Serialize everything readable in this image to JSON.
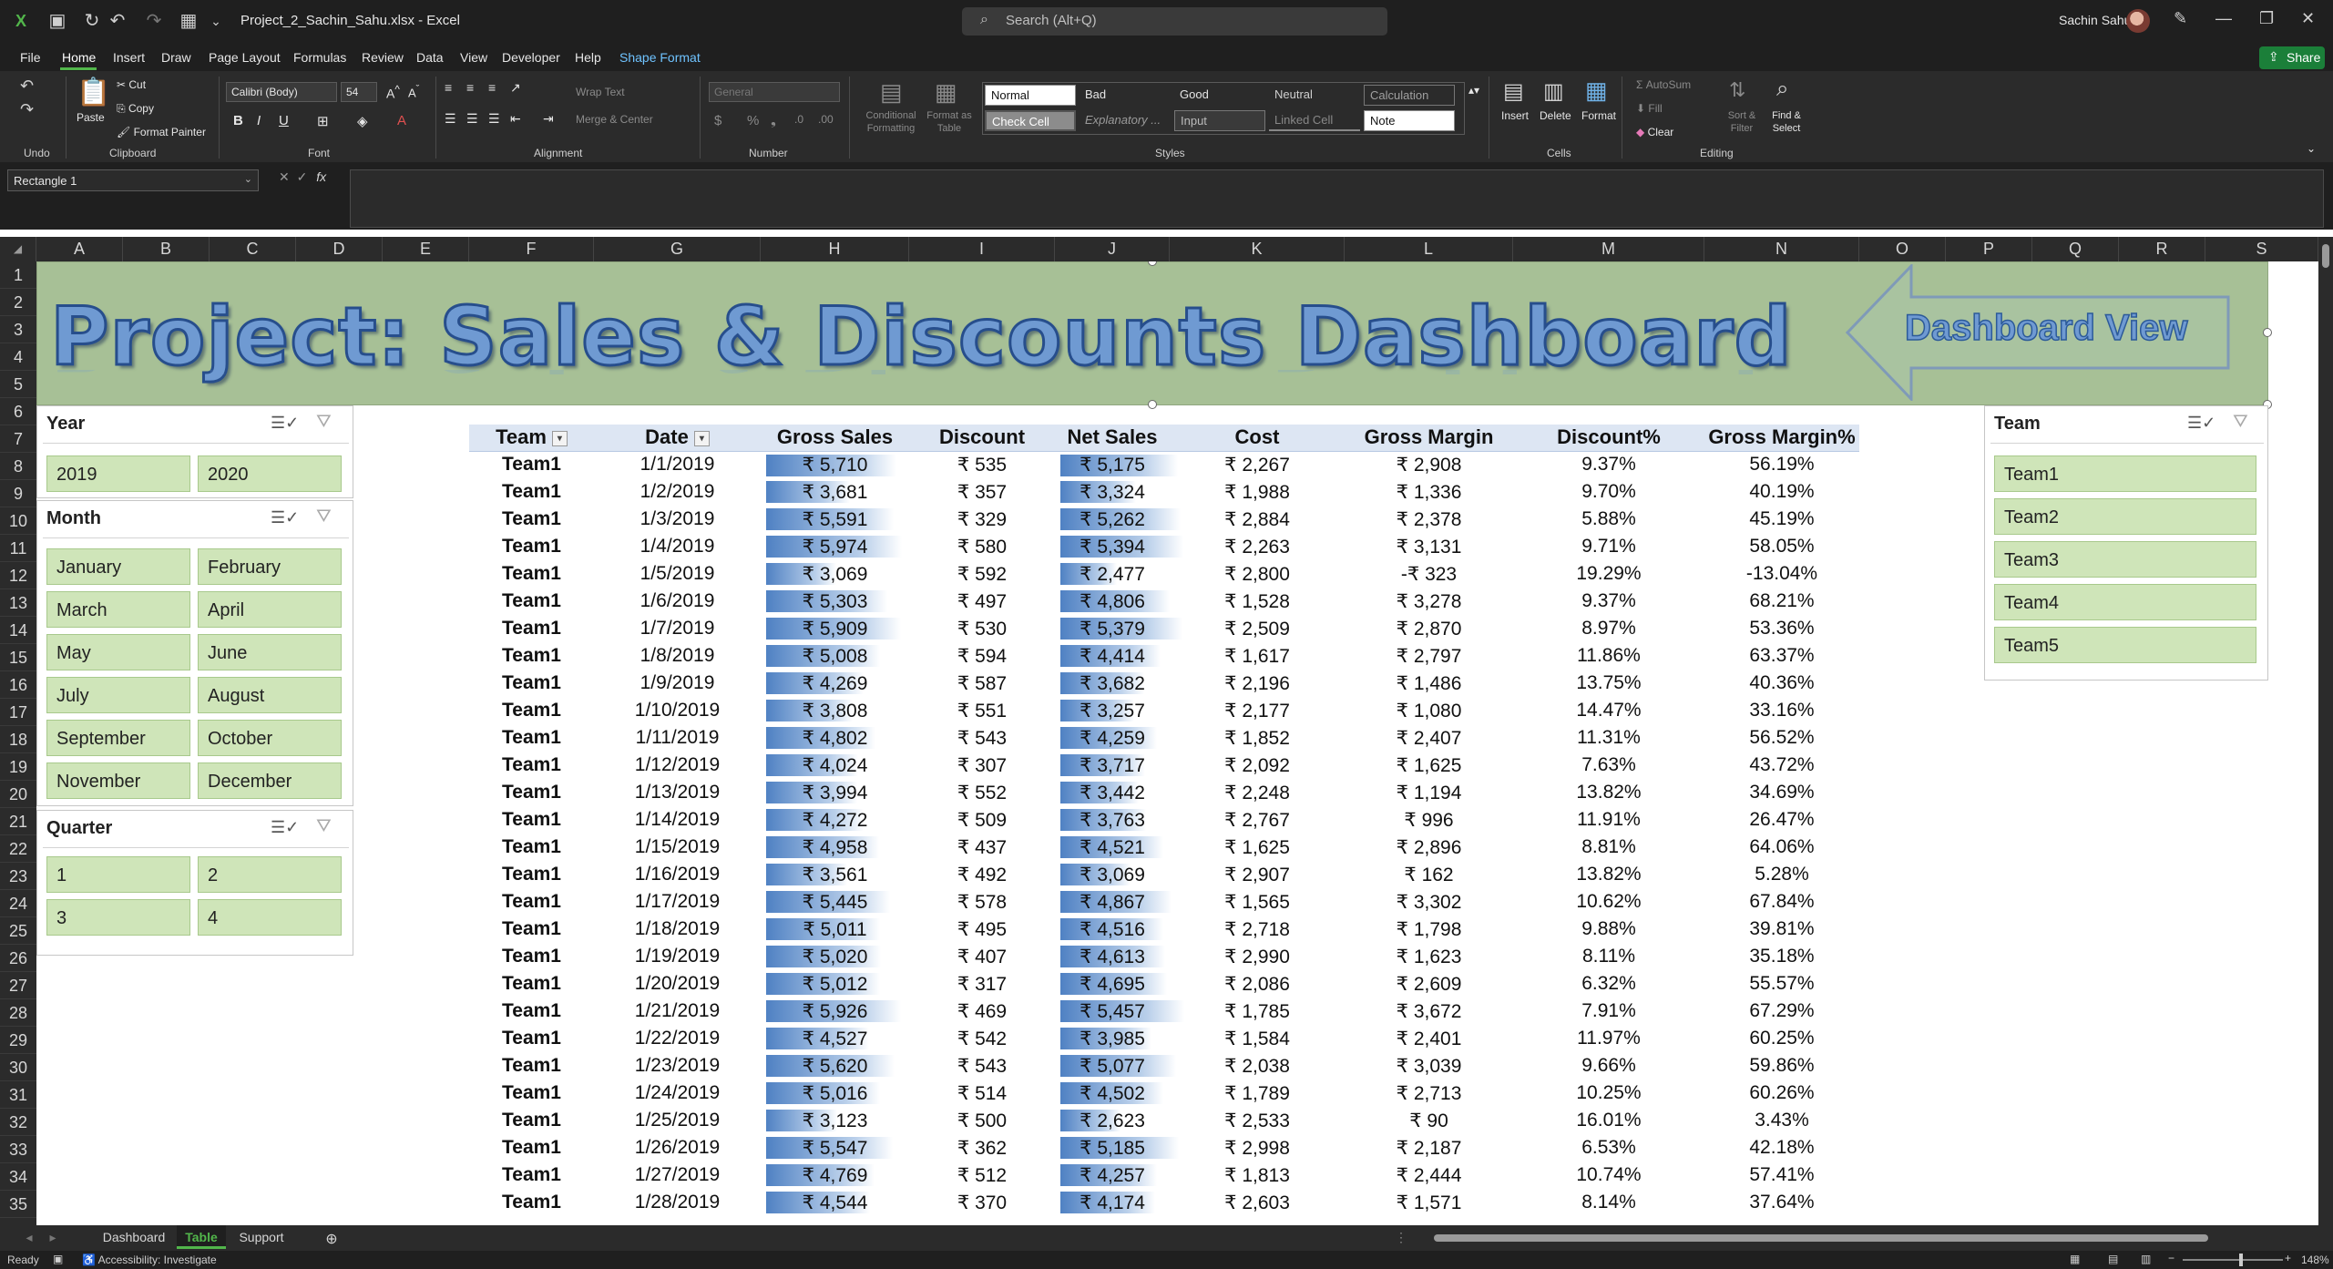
{
  "window": {
    "file_name": "Project_2_Sachin_Sahu.xlsx",
    "app_name": "Excel",
    "title": "Project_2_Sachin_Sahu.xlsx  -  Excel",
    "search_placeholder": "Search (Alt+Q)",
    "user_name": "Sachin Sahu"
  },
  "menu": [
    "File",
    "Home",
    "Insert",
    "Draw",
    "Page Layout",
    "Formulas",
    "Review",
    "Data",
    "View",
    "Developer",
    "Help",
    "Shape Format"
  ],
  "share_label": "Share",
  "ribbon": {
    "undo": "Undo",
    "clipboard": {
      "paste": "Paste",
      "cut": "Cut",
      "copy": "Copy",
      "format_painter": "Format Painter",
      "label": "Clipboard"
    },
    "font": {
      "family": "Calibri (Body)",
      "size": "54",
      "label": "Font"
    },
    "alignment": {
      "wrap_text": "Wrap Text",
      "merge_center": "Merge & Center",
      "label": "Alignment"
    },
    "number": {
      "format": "General",
      "label": "Number"
    },
    "styles": {
      "conditional": "Conditional Formatting",
      "format_table": "Format as Table",
      "label": "Styles",
      "cells": [
        "Normal",
        "Bad",
        "Good",
        "Neutral",
        "Calculation",
        "Check Cell",
        "Explanatory ...",
        "Input",
        "Linked Cell",
        "Note"
      ]
    },
    "cells": {
      "insert": "Insert",
      "delete": "Delete",
      "format": "Format",
      "label": "Cells"
    },
    "editing": {
      "autosum": "AutoSum",
      "fill": "Fill",
      "clear": "Clear",
      "sort_filter": "Sort & Filter",
      "find_select": "Find & Select",
      "label": "Editing"
    }
  },
  "formula_bar": {
    "name_box": "Rectangle 1",
    "formula": ""
  },
  "columns": [
    "A",
    "B",
    "C",
    "D",
    "E",
    "F",
    "G",
    "H",
    "I",
    "J",
    "K",
    "L",
    "M",
    "N",
    "O",
    "P",
    "Q",
    "R",
    "S"
  ],
  "rows": [
    "1",
    "2",
    "3",
    "4",
    "5",
    "6",
    "7",
    "8",
    "9",
    "10",
    "11",
    "12",
    "13",
    "14",
    "15",
    "16",
    "17",
    "18",
    "19",
    "20",
    "21",
    "22",
    "23",
    "24",
    "25",
    "26",
    "27",
    "28",
    "29",
    "30",
    "31",
    "32",
    "33",
    "34",
    "35"
  ],
  "banner": {
    "title": "Project:  Sales & Discounts Dashboard",
    "button": "Dashboard View"
  },
  "slicers": {
    "year": {
      "title": "Year",
      "items": [
        "2019",
        "2020"
      ]
    },
    "month": {
      "title": "Month",
      "items": [
        "January",
        "February",
        "March",
        "April",
        "May",
        "June",
        "July",
        "August",
        "September",
        "October",
        "November",
        "December"
      ]
    },
    "quarter": {
      "title": "Quarter",
      "items": [
        "1",
        "2",
        "3",
        "4"
      ]
    },
    "team": {
      "title": "Team",
      "items": [
        "Team1",
        "Team2",
        "Team3",
        "Team4",
        "Team5"
      ]
    }
  },
  "table": {
    "headers": [
      "Team",
      "Date",
      "Gross Sales",
      "Discount",
      "Net Sales",
      "Cost",
      "Gross Margin",
      "Discount%",
      "Gross Margin%"
    ],
    "rows": [
      [
        "Team1",
        "1/1/2019",
        "₹ 5,710",
        "₹ 535",
        "₹ 5,175",
        "₹ 2,267",
        "₹ 2,908",
        "9.37%",
        "56.19%"
      ],
      [
        "Team1",
        "1/2/2019",
        "₹ 3,681",
        "₹ 357",
        "₹ 3,324",
        "₹ 1,988",
        "₹ 1,336",
        "9.70%",
        "40.19%"
      ],
      [
        "Team1",
        "1/3/2019",
        "₹ 5,591",
        "₹ 329",
        "₹ 5,262",
        "₹ 2,884",
        "₹ 2,378",
        "5.88%",
        "45.19%"
      ],
      [
        "Team1",
        "1/4/2019",
        "₹ 5,974",
        "₹ 580",
        "₹ 5,394",
        "₹ 2,263",
        "₹ 3,131",
        "9.71%",
        "58.05%"
      ],
      [
        "Team1",
        "1/5/2019",
        "₹ 3,069",
        "₹ 592",
        "₹ 2,477",
        "₹ 2,800",
        "-₹ 323",
        "19.29%",
        "-13.04%"
      ],
      [
        "Team1",
        "1/6/2019",
        "₹ 5,303",
        "₹ 497",
        "₹ 4,806",
        "₹ 1,528",
        "₹ 3,278",
        "9.37%",
        "68.21%"
      ],
      [
        "Team1",
        "1/7/2019",
        "₹ 5,909",
        "₹ 530",
        "₹ 5,379",
        "₹ 2,509",
        "₹ 2,870",
        "8.97%",
        "53.36%"
      ],
      [
        "Team1",
        "1/8/2019",
        "₹ 5,008",
        "₹ 594",
        "₹ 4,414",
        "₹ 1,617",
        "₹ 2,797",
        "11.86%",
        "63.37%"
      ],
      [
        "Team1",
        "1/9/2019",
        "₹ 4,269",
        "₹ 587",
        "₹ 3,682",
        "₹ 2,196",
        "₹ 1,486",
        "13.75%",
        "40.36%"
      ],
      [
        "Team1",
        "1/10/2019",
        "₹ 3,808",
        "₹ 551",
        "₹ 3,257",
        "₹ 2,177",
        "₹ 1,080",
        "14.47%",
        "33.16%"
      ],
      [
        "Team1",
        "1/11/2019",
        "₹ 4,802",
        "₹ 543",
        "₹ 4,259",
        "₹ 1,852",
        "₹ 2,407",
        "11.31%",
        "56.52%"
      ],
      [
        "Team1",
        "1/12/2019",
        "₹ 4,024",
        "₹ 307",
        "₹ 3,717",
        "₹ 2,092",
        "₹ 1,625",
        "7.63%",
        "43.72%"
      ],
      [
        "Team1",
        "1/13/2019",
        "₹ 3,994",
        "₹ 552",
        "₹ 3,442",
        "₹ 2,248",
        "₹ 1,194",
        "13.82%",
        "34.69%"
      ],
      [
        "Team1",
        "1/14/2019",
        "₹ 4,272",
        "₹ 509",
        "₹ 3,763",
        "₹ 2,767",
        "₹ 996",
        "11.91%",
        "26.47%"
      ],
      [
        "Team1",
        "1/15/2019",
        "₹ 4,958",
        "₹ 437",
        "₹ 4,521",
        "₹ 1,625",
        "₹ 2,896",
        "8.81%",
        "64.06%"
      ],
      [
        "Team1",
        "1/16/2019",
        "₹ 3,561",
        "₹ 492",
        "₹ 3,069",
        "₹ 2,907",
        "₹ 162",
        "13.82%",
        "5.28%"
      ],
      [
        "Team1",
        "1/17/2019",
        "₹ 5,445",
        "₹ 578",
        "₹ 4,867",
        "₹ 1,565",
        "₹ 3,302",
        "10.62%",
        "67.84%"
      ],
      [
        "Team1",
        "1/18/2019",
        "₹ 5,011",
        "₹ 495",
        "₹ 4,516",
        "₹ 2,718",
        "₹ 1,798",
        "9.88%",
        "39.81%"
      ],
      [
        "Team1",
        "1/19/2019",
        "₹ 5,020",
        "₹ 407",
        "₹ 4,613",
        "₹ 2,990",
        "₹ 1,623",
        "8.11%",
        "35.18%"
      ],
      [
        "Team1",
        "1/20/2019",
        "₹ 5,012",
        "₹ 317",
        "₹ 4,695",
        "₹ 2,086",
        "₹ 2,609",
        "6.32%",
        "55.57%"
      ],
      [
        "Team1",
        "1/21/2019",
        "₹ 5,926",
        "₹ 469",
        "₹ 5,457",
        "₹ 1,785",
        "₹ 3,672",
        "7.91%",
        "67.29%"
      ],
      [
        "Team1",
        "1/22/2019",
        "₹ 4,527",
        "₹ 542",
        "₹ 3,985",
        "₹ 1,584",
        "₹ 2,401",
        "11.97%",
        "60.25%"
      ],
      [
        "Team1",
        "1/23/2019",
        "₹ 5,620",
        "₹ 543",
        "₹ 5,077",
        "₹ 2,038",
        "₹ 3,039",
        "9.66%",
        "59.86%"
      ],
      [
        "Team1",
        "1/24/2019",
        "₹ 5,016",
        "₹ 514",
        "₹ 4,502",
        "₹ 1,789",
        "₹ 2,713",
        "10.25%",
        "60.26%"
      ],
      [
        "Team1",
        "1/25/2019",
        "₹ 3,123",
        "₹ 500",
        "₹ 2,623",
        "₹ 2,533",
        "₹ 90",
        "16.01%",
        "3.43%"
      ],
      [
        "Team1",
        "1/26/2019",
        "₹ 5,547",
        "₹ 362",
        "₹ 5,185",
        "₹ 2,998",
        "₹ 2,187",
        "6.53%",
        "42.18%"
      ],
      [
        "Team1",
        "1/27/2019",
        "₹ 4,769",
        "₹ 512",
        "₹ 4,257",
        "₹ 1,813",
        "₹ 2,444",
        "10.74%",
        "57.41%"
      ],
      [
        "Team1",
        "1/28/2019",
        "₹ 4,544",
        "₹ 370",
        "₹ 4,174",
        "₹ 2,603",
        "₹ 1,571",
        "8.14%",
        "37.64%"
      ]
    ]
  },
  "sheet_tabs": [
    "Dashboard",
    "Table",
    "Support"
  ],
  "active_tab": "Table",
  "status": {
    "ready": "Ready",
    "accessibility": "Accessibility: Investigate",
    "zoom": "148%"
  },
  "colors": {
    "accent": "#52b64b",
    "banner": "#a7c096",
    "slicer_button": "#cfe5b9",
    "title_text": "#6f9ad2",
    "databar": "#4f81c3"
  }
}
